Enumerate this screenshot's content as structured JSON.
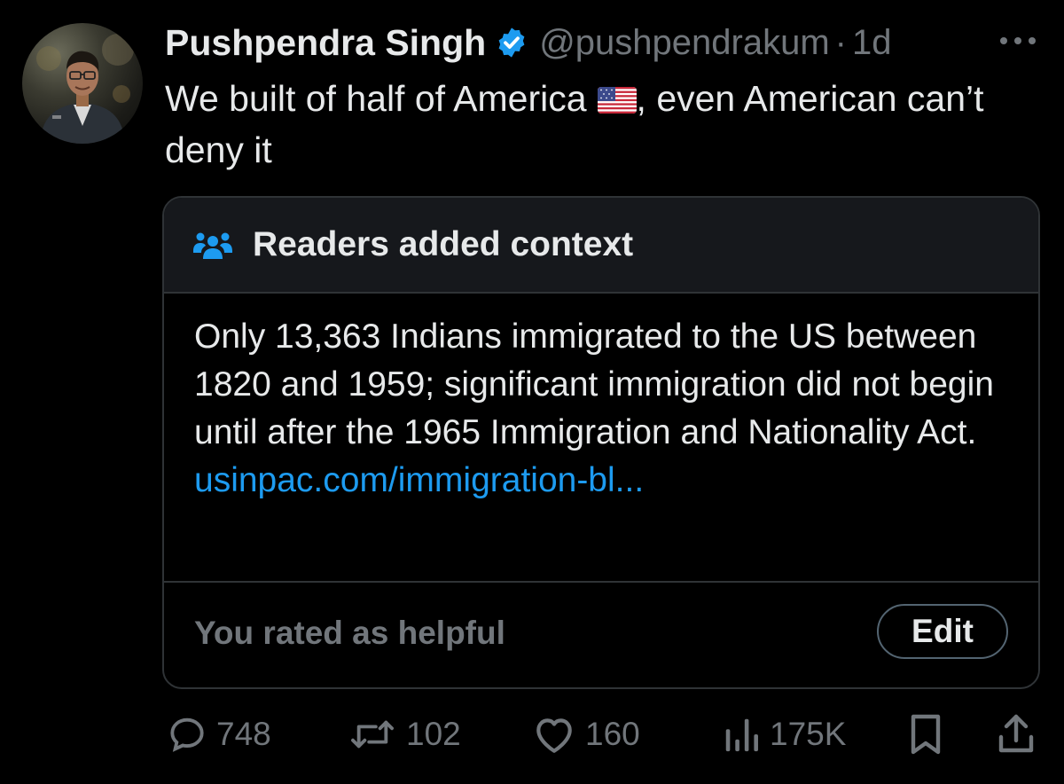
{
  "tweet": {
    "author": {
      "display_name": "Pushpendra Singh",
      "handle": "@pushpendrakum",
      "verified": true
    },
    "separator": "·",
    "time": "1d",
    "text_before_flag": "We built of half of America",
    "text_after_flag": ", even American can’t deny it",
    "flag_icon": "us-flag-icon"
  },
  "community_note": {
    "title": "Readers added context",
    "body": "Only 13,363 Indians immigrated to the US between 1820 and 1959; significant immigration did not begin until after the 1965 Immigration and Nationality Act.",
    "link": "usinpac.com/immigration-bl...",
    "rating_status": "You rated as helpful",
    "edit_label": "Edit"
  },
  "actions": {
    "replies": "748",
    "reposts": "102",
    "likes": "160",
    "views": "175K"
  },
  "colors": {
    "background": "#000000",
    "text": "#e7e9ea",
    "muted": "#71767b",
    "link": "#1d9bf0",
    "verified": "#1d9bf0",
    "border": "#2f3336",
    "note_header_bg": "#16181c"
  }
}
